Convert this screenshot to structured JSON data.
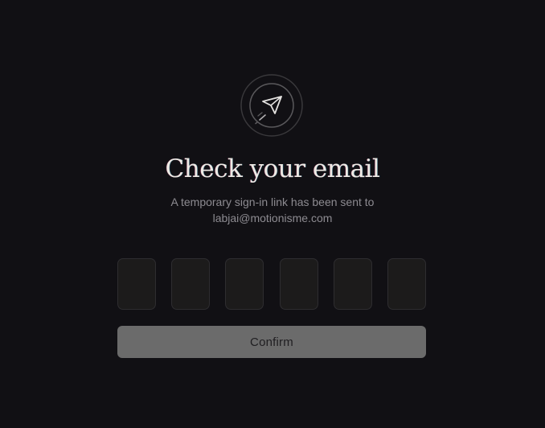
{
  "colors": {
    "background": "#111014",
    "title": "#eeeae4",
    "subtitle": "#8d8b91",
    "input_bg": "#1c1b1b",
    "input_border": "#2e2d30",
    "button_bg": "#6b6b6b",
    "button_text": "#1f1e21"
  },
  "icon": {
    "name": "paper-plane-icon"
  },
  "header": {
    "title": "Check your email",
    "subtitle_line1": "A temporary sign-in link has been sent to",
    "subtitle_line2": "labjai@motionisme.com"
  },
  "code_inputs": [
    {
      "value": ""
    },
    {
      "value": ""
    },
    {
      "value": ""
    },
    {
      "value": ""
    },
    {
      "value": ""
    },
    {
      "value": ""
    }
  ],
  "actions": {
    "confirm_label": "Confirm"
  }
}
